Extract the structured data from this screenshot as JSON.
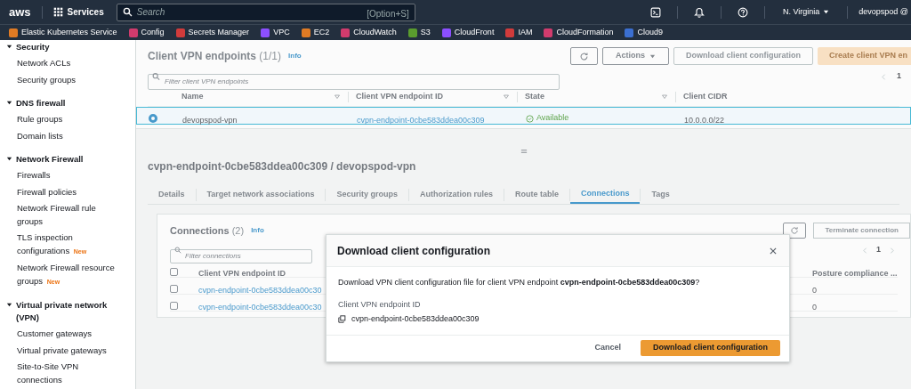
{
  "top_nav": {
    "logo": "aws",
    "services": "Services",
    "search": {
      "placeholder": "Search",
      "shortcut": "[Option+S]"
    },
    "region": "N. Virginia",
    "account": "devopspod @"
  },
  "favorites": [
    {
      "label": "Elastic Kubernetes Service",
      "color": "#e07b24"
    },
    {
      "label": "Config",
      "color": "#d13b6d"
    },
    {
      "label": "Secrets Manager",
      "color": "#d13b3b"
    },
    {
      "label": "VPC",
      "color": "#8c4fff"
    },
    {
      "label": "EC2",
      "color": "#e07b24"
    },
    {
      "label": "CloudWatch",
      "color": "#d13b6d"
    },
    {
      "label": "S3",
      "color": "#5a9c2e"
    },
    {
      "label": "CloudFront",
      "color": "#8c4fff"
    },
    {
      "label": "IAM",
      "color": "#d13b3b"
    },
    {
      "label": "CloudFormation",
      "color": "#d13b6d"
    },
    {
      "label": "Cloud9",
      "color": "#3b6fd1"
    }
  ],
  "sidebar": [
    {
      "label": "Security",
      "expanded": true,
      "children": [
        {
          "label": "Network ACLs"
        },
        {
          "label": "Security groups"
        }
      ]
    },
    {
      "label": "DNS firewall",
      "expanded": true,
      "children": [
        {
          "label": "Rule groups"
        },
        {
          "label": "Domain lists"
        }
      ]
    },
    {
      "label": "Network Firewall",
      "expanded": true,
      "children": [
        {
          "label": "Firewalls"
        },
        {
          "label": "Firewall policies"
        },
        {
          "label": "Network Firewall rule groups"
        },
        {
          "label": "TLS inspection configurations",
          "badge": "New"
        },
        {
          "label": "Network Firewall resource groups",
          "badge": "New"
        }
      ]
    },
    {
      "label": "Virtual private network (VPN)",
      "expanded": true,
      "children": [
        {
          "label": "Customer gateways"
        },
        {
          "label": "Virtual private gateways"
        },
        {
          "label": "Site-to-Site VPN connections"
        }
      ]
    }
  ],
  "endpoints": {
    "title": "Client VPN endpoints",
    "count": "(1/1)",
    "info": "Info",
    "actions": "Actions",
    "download": "Download client configuration",
    "create": "Create client VPN en",
    "filter_placeholder": "Filter client VPN endpoints",
    "page": "1",
    "columns": [
      "Name",
      "Client VPN endpoint ID",
      "State",
      "Client CIDR"
    ],
    "rows": [
      {
        "selected": true,
        "name": "devopspod-vpn",
        "id": "cvpn-endpoint-0cbe583ddea00c309",
        "state": "Available",
        "cidr": "10.0.0.0/22"
      }
    ]
  },
  "detail": {
    "title": "cvpn-endpoint-0cbe583ddea00c309 / devopspod-vpn",
    "tabs": [
      {
        "label": "Details",
        "selected": false
      },
      {
        "label": "Target network associations",
        "selected": false
      },
      {
        "label": "Security groups",
        "selected": false
      },
      {
        "label": "Authorization rules",
        "selected": false
      },
      {
        "label": "Route table",
        "selected": false
      },
      {
        "label": "Connections",
        "selected": true
      },
      {
        "label": "Tags",
        "selected": false
      }
    ],
    "connections": {
      "title": "Connections",
      "count": "(2)",
      "info": "Info",
      "terminate": "Terminate connection",
      "filter_placeholder": "Filter connections",
      "page": "1",
      "all_checked": false,
      "columns": [
        "Client VPN endpoint ID",
        "Posture compliance ..."
      ],
      "rows": [
        {
          "checked": false,
          "id": "cvpn-endpoint-0cbe583ddea00c30",
          "posture": "0"
        },
        {
          "checked": false,
          "id": "cvpn-endpoint-0cbe583ddea00c30",
          "posture": "0"
        }
      ]
    }
  },
  "dialog": {
    "title": "Download client configuration",
    "message": "Download VPN client configuration file for client VPN endpoint **cvpn-endpoint-0cbe583ddea00c309**?",
    "field_label": "Client VPN endpoint ID",
    "field_value": "cvpn-endpoint-0cbe583ddea00c309",
    "buttons": [
      {
        "label": "Cancel",
        "kind": "secondary"
      },
      {
        "label": "Download client configuration",
        "kind": "primary"
      }
    ]
  }
}
